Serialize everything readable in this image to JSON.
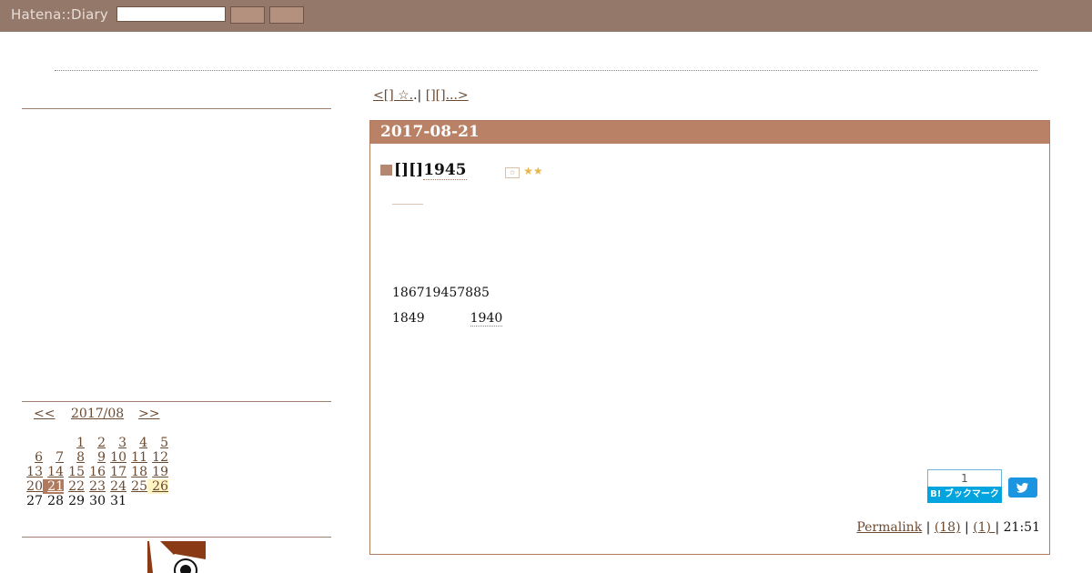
{
  "topbar": {
    "logo": "Hatena::Diary",
    "search_value": "",
    "button1_label": "",
    "button2_label": ""
  },
  "calendar": {
    "prev": "<<",
    "month": "2017/08",
    "next": ">>",
    "weeks": [
      [
        "",
        "",
        "",
        "1",
        "2",
        "3",
        "4",
        "5"
      ],
      [
        "",
        "6",
        "7",
        "8",
        "9",
        "10",
        "11",
        "12"
      ],
      [
        "",
        "13",
        "14",
        "15",
        "16",
        "17",
        "18",
        "19"
      ],
      [
        "",
        "20",
        "21",
        "22",
        "23",
        "24",
        "25",
        "26"
      ],
      [
        "",
        "27",
        "28",
        "29",
        "30",
        "31",
        "",
        ""
      ]
    ],
    "today": "21",
    "highlight": "26",
    "unlinked_from": "27"
  },
  "pager": {
    "prev_link": "<[]              ☆.",
    "middle": ".| ",
    "next_link": "[][]...>           "
  },
  "day": {
    "date": "2017-08-21",
    "section_prefix": "[][]",
    "section_title": "1945",
    "stars": "★★",
    "line1": "186719457885",
    "line2_a": "1849",
    "line2_b": "1940",
    "hatebu_count": "1",
    "hatebu_label": "B! ブックマーク",
    "footer": {
      "permalink": "Permalink",
      "sep1": " | ",
      "comments": "(18)",
      "sep2": " | ",
      "trackback": "(1)      ",
      "sep3": " | ",
      "time": "21:51"
    }
  }
}
